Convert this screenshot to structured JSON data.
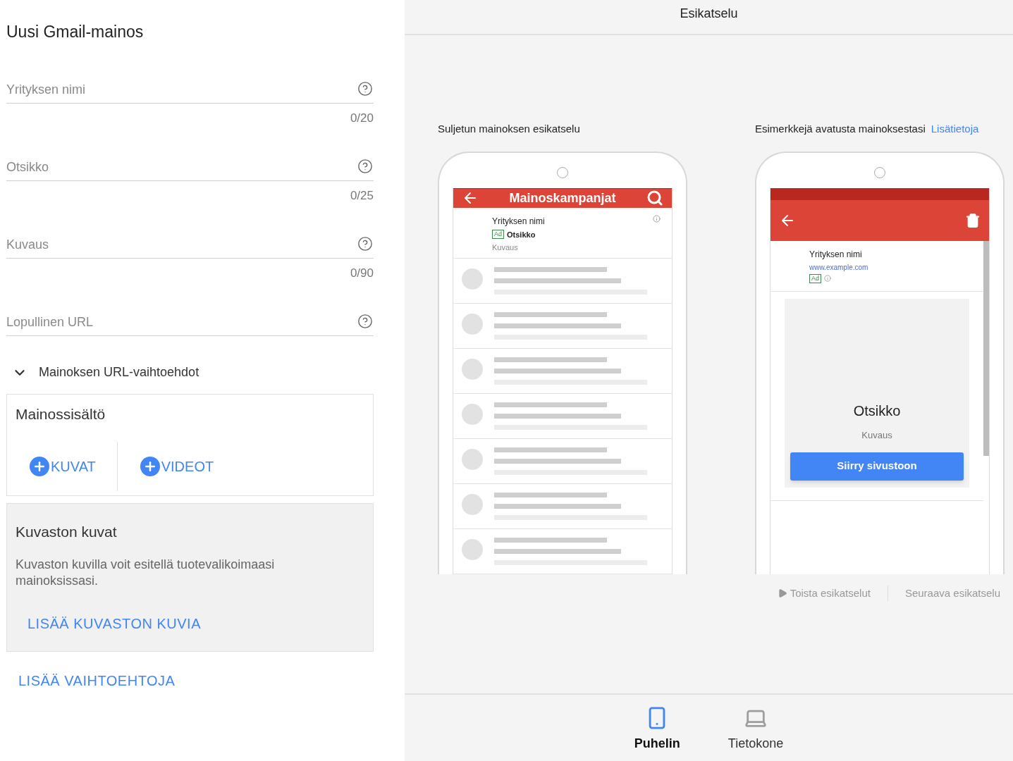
{
  "form": {
    "title": "Uusi Gmail-mainos",
    "fields": [
      {
        "placeholder": "Yrityksen nimi",
        "counter": "0/20"
      },
      {
        "placeholder": "Otsikko",
        "counter": "0/25"
      },
      {
        "placeholder": "Kuvaus",
        "counter": "0/90"
      },
      {
        "placeholder": "Lopullinen URL"
      }
    ],
    "url_options": {
      "label": "Mainoksen URL-vaihtoehdot",
      "expanded": false
    },
    "content": {
      "title": "Mainossisältö",
      "buttons": [
        "KUVAT",
        "VIDEOT"
      ]
    },
    "catalog": {
      "title": "Kuvaston kuvat",
      "description": "Kuvaston kuvilla voit esitellä tuotevalikoimaasi mainoksissasi.",
      "link": "LISÄÄ KUVASTON KUVIA"
    },
    "more_link": "LISÄÄ VAIHTOEHTOJA"
  },
  "preview": {
    "title": "Esikatselu",
    "collapsed": {
      "caption": "Suljetun mainoksen esikatselu",
      "toolbar_title": "Mainoskampanjat",
      "company": "Yrityksen nimi",
      "ad_badge": "Ad",
      "headline": "Otsikko",
      "description": "Kuvaus"
    },
    "expanded": {
      "caption": "Esimerkkejä avatusta mainoksestasi",
      "link": "Lisätietoja",
      "company": "Yrityksen nimi",
      "url": "www.example.com",
      "ad_badge": "Ad",
      "headline": "Otsikko",
      "description": "Kuvaus",
      "cta": "Siirry sivustoon"
    },
    "controls": [
      {
        "label": "Toista esikatselut",
        "kind": "play"
      },
      {
        "label": "Seuraava esikatselu",
        "kind": "text"
      }
    ]
  },
  "devices": [
    {
      "label": "Puhelin",
      "kind": "phone",
      "selected": true
    },
    {
      "label": "Tietokone",
      "kind": "laptop",
      "selected": false
    }
  ]
}
